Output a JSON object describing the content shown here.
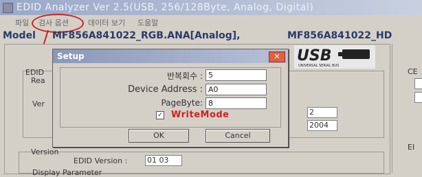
{
  "app": {
    "title": "EDID Analyzer Ver 2.5(USB, 256/128Byte, Analog, Digital)",
    "menu": [
      "파일",
      "검사 옵션",
      "데이터 보기",
      "도움말"
    ]
  },
  "model_bar": {
    "label": "Model",
    "model_a": "MF856A841022_RGB.ANA[Analog],",
    "model_b": "MF856A841022_HD"
  },
  "main": {
    "edid_group_label": "EDID",
    "read_label": "Rea",
    "ver_label": "Ver",
    "field_a": "2",
    "field_b": "2004",
    "version_group_label": "Version",
    "edid_version_label": "EDID Version :",
    "edid_version_value": "01  03",
    "display_param_label": "Display Parameter"
  },
  "logo": {
    "text": "USB",
    "subtext": "UNIVERSAL SERIAL BUS"
  },
  "right_panel": {
    "label_a": "CE",
    "label_b": "EI"
  },
  "dialog": {
    "title": "Setup",
    "close_glyph": "✕",
    "repeat_label": "반복회수 :",
    "repeat_value": "5",
    "address_label": "Device Address :",
    "address_value": "A0",
    "pagebyte_label": "PageByte:",
    "pagebyte_value": "8",
    "check_glyph": "✓",
    "writemode_label": "WriteMode",
    "ok_label": "OK",
    "cancel_label": "Cancel"
  },
  "colors": {
    "annotation_red": "#d02020",
    "model_text": "#2a3a6a"
  }
}
